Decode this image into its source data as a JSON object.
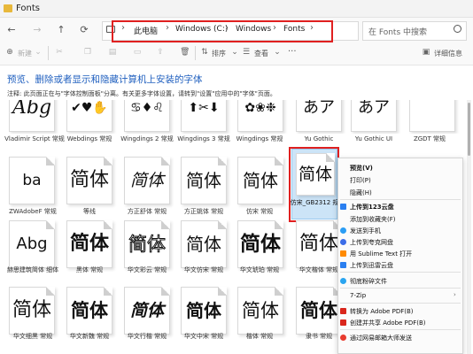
{
  "window": {
    "title": "Fonts"
  },
  "address": {
    "crumbs": [
      "此电脑",
      "Windows (C:)",
      "Windows",
      "Fonts"
    ],
    "search_placeholder": "在 Fonts 中搜索"
  },
  "toolbar": {
    "new_label": "新建",
    "sort_label": "排序",
    "view_label": "查看",
    "more_label": "···",
    "details_label": "详细信息"
  },
  "page": {
    "heading": "预览、删除或者显示和隐藏计算机上安装的字体",
    "note": "注释: 此页面正在与\"字体控制面板\"分离。有关更多字体设置，请转到\"设置\"应用中的\"字体\"页面。"
  },
  "fonts": {
    "row1": [
      {
        "sample": "Abg",
        "label": "Vladimir Script 常规"
      },
      {
        "sample": "✔♥✋",
        "label": "Webdings 常规"
      },
      {
        "sample": "♋♦♌",
        "label": "Wingdings 2 常规"
      },
      {
        "sample": "⬆✂⬇",
        "label": "Wingdings 3 常规"
      },
      {
        "sample": "✿❀❉",
        "label": "Wingdings 常规"
      },
      {
        "sample": "あア",
        "label": "Yu Gothic"
      },
      {
        "sample": "あア",
        "label": "Yu Gothic UI"
      },
      {
        "sample": "",
        "label": "ZGDT 常规"
      }
    ],
    "row2": [
      {
        "sample": "ba",
        "label": "ZWAdobeF 常规"
      },
      {
        "sample": "简体",
        "label": "等线"
      },
      {
        "sample": "简体",
        "label": "方正舒体 常规"
      },
      {
        "sample": "简体",
        "label": "方正姚体 常规"
      },
      {
        "sample": "简体",
        "label": "仿宋 常规"
      },
      {
        "sample": "简体",
        "label": "仿宋_GB2312 规"
      }
    ],
    "row3": [
      {
        "sample": "Abg",
        "label": "赫思建筑简体 细体"
      },
      {
        "sample": "简体",
        "label": "黑体 常规"
      },
      {
        "sample": "简体",
        "label": "华文彩云 常规"
      },
      {
        "sample": "简体",
        "label": "华文仿宋 常规"
      },
      {
        "sample": "简体",
        "label": "华文琥珀 常规"
      },
      {
        "sample": "简体",
        "label": "华文楷体 常规"
      }
    ],
    "row4": [
      {
        "sample": "简体",
        "label": "华文细黑 常规"
      },
      {
        "sample": "简体",
        "label": "华文新魏 常规"
      },
      {
        "sample": "简体",
        "label": "华文行楷 常规"
      },
      {
        "sample": "简体",
        "label": "华文中宋 常规"
      },
      {
        "sample": "简体",
        "label": "楷体 常规"
      },
      {
        "sample": "简体",
        "label": "隶书 常规"
      }
    ]
  },
  "context_menu": {
    "items": [
      {
        "label": "预览(V)",
        "bold": true,
        "icon": "",
        "color": ""
      },
      {
        "label": "打印(P)",
        "bold": false,
        "icon": "",
        "color": ""
      },
      {
        "label": "隐藏(H)",
        "bold": false,
        "icon": "",
        "color": ""
      },
      {
        "label": "上传到123云盘",
        "bold": true,
        "icon": "cloud-icon",
        "color": "#2a7ff0"
      },
      {
        "label": "添加到收藏夹(F)",
        "bold": false,
        "icon": "",
        "color": ""
      },
      {
        "label": "发送到手机",
        "bold": false,
        "icon": "phone-icon",
        "color": "#2a9df4"
      },
      {
        "label": "上传到夸克网盘",
        "bold": false,
        "icon": "quark-icon",
        "color": "#3b6de8"
      },
      {
        "label": "用 Sublime Text 打开",
        "bold": false,
        "icon": "sublime-icon",
        "color": "#ff8a00"
      },
      {
        "label": "上传到迅雷云盘",
        "bold": false,
        "icon": "thunder-icon",
        "color": "#2a7ff0"
      },
      {
        "label": "彻底粉碎文件",
        "bold": false,
        "icon": "shred-icon",
        "color": "#2aa5f0"
      },
      {
        "label": "7-Zip",
        "bold": false,
        "icon": "",
        "color": ""
      },
      {
        "label": "转换为 Adobe PDF(B)",
        "bold": false,
        "icon": "pdf-icon",
        "color": "#d9261c"
      },
      {
        "label": "创建并共享 Adobe PDF(B)",
        "bold": false,
        "icon": "pdf-icon",
        "color": "#d9261c"
      },
      {
        "label": "通过网易邮箱大师发送",
        "bold": false,
        "icon": "mail-icon",
        "color": "#e83b2e"
      }
    ]
  },
  "colors": {
    "accent": "#1f5fbf",
    "highlight": "#e02020",
    "selection": "#cce4f7"
  }
}
